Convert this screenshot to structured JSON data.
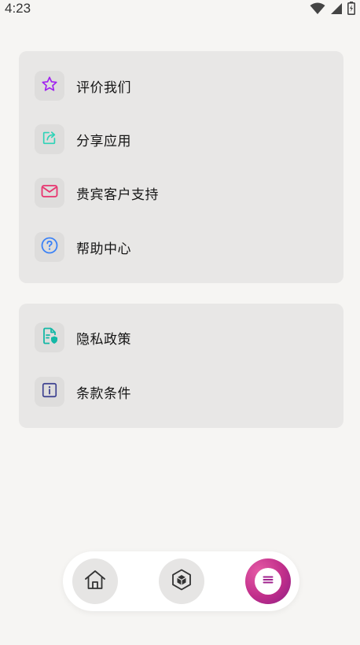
{
  "status_bar": {
    "time": "4:23",
    "icons": [
      "wifi-icon",
      "signal-icon",
      "battery-icon"
    ]
  },
  "group_1": {
    "items": [
      {
        "label": "评价我们",
        "icon": "star-icon",
        "color": "#a020f0"
      },
      {
        "label": "分享应用",
        "icon": "share-icon",
        "color": "#2ed3b7"
      },
      {
        "label": "贵宾客户支持",
        "icon": "mail-icon",
        "color": "#e8336e"
      },
      {
        "label": "帮助中心",
        "icon": "help-icon",
        "color": "#3b82f6"
      }
    ]
  },
  "group_2": {
    "items": [
      {
        "label": "隐私政策",
        "icon": "privacy-doc-icon",
        "color": "#14b8a6"
      },
      {
        "label": "条款条件",
        "icon": "info-icon",
        "color": "#3b3f8f"
      }
    ]
  },
  "bottom_nav": {
    "items": [
      {
        "icon": "home-icon",
        "active": false
      },
      {
        "icon": "cube-icon",
        "active": false
      },
      {
        "icon": "menu-icon",
        "active": true
      }
    ],
    "active_gradient": [
      "#e55aa5",
      "#8a1e86"
    ]
  }
}
